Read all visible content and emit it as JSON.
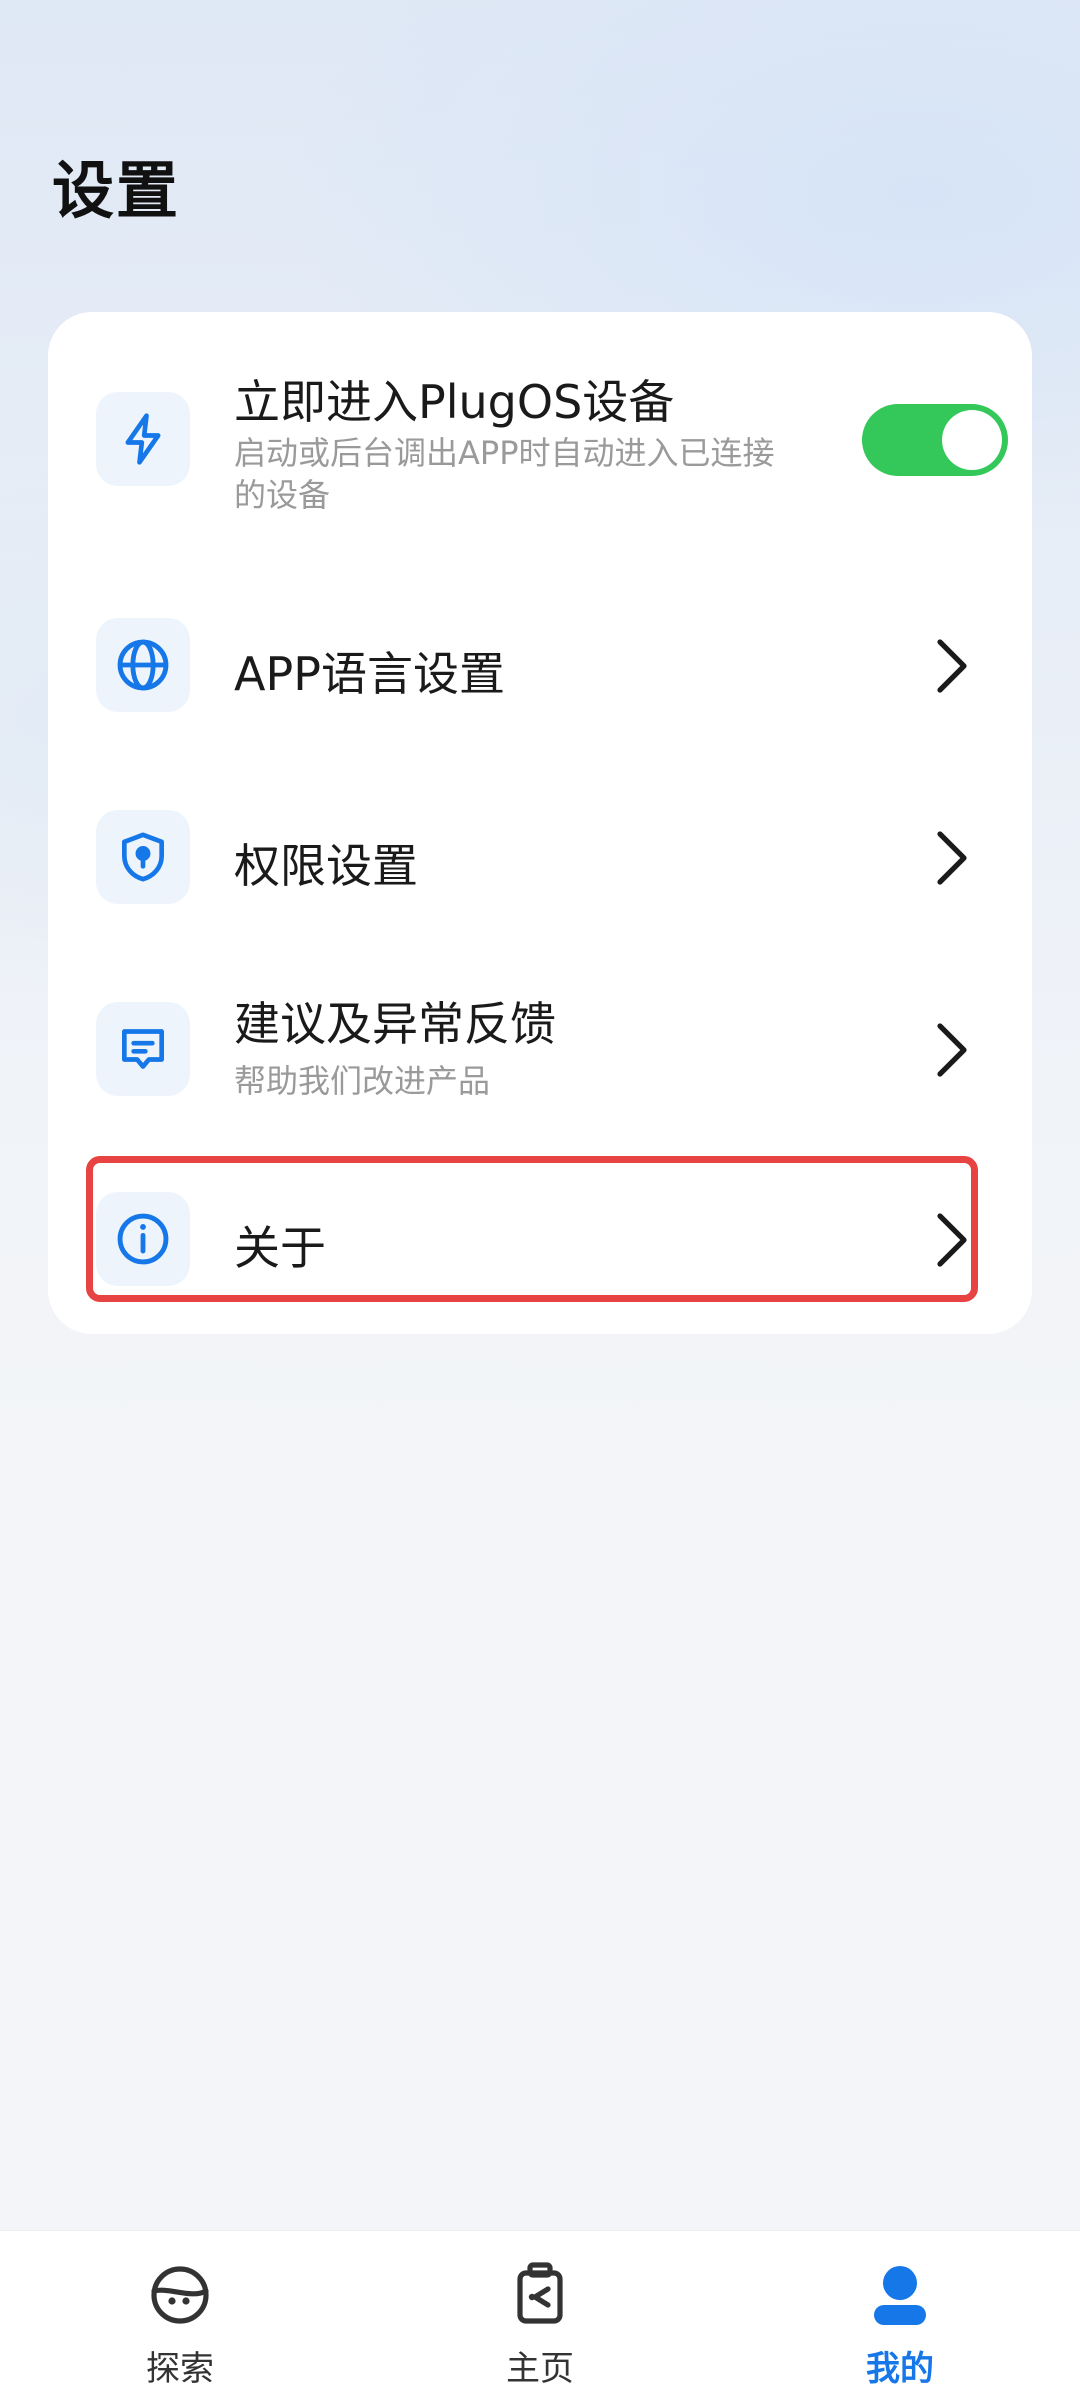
{
  "header": {
    "title": "设置"
  },
  "settings": {
    "items": [
      {
        "title": "立即进入PlugOS设备",
        "subtitle": "启动或后台调出APP时自动进入已连接的设备",
        "icon": "lightning-icon",
        "control": "toggle",
        "toggle_on": true
      },
      {
        "title": "APP语言设置",
        "icon": "globe-icon",
        "control": "chevron"
      },
      {
        "title": "权限设置",
        "icon": "shield-icon",
        "control": "chevron"
      },
      {
        "title": "建议及异常反馈",
        "subtitle": "帮助我们改进产品",
        "icon": "message-icon",
        "control": "chevron"
      },
      {
        "title": "关于",
        "icon": "info-icon",
        "control": "chevron",
        "highlighted": true
      }
    ]
  },
  "tabbar": {
    "tabs": [
      {
        "label": "探索",
        "icon": "explore-icon",
        "active": false
      },
      {
        "label": "主页",
        "icon": "home-device-icon",
        "active": false
      },
      {
        "label": "我的",
        "icon": "profile-icon",
        "active": true
      }
    ]
  },
  "colors": {
    "accent": "#1677e8",
    "toggle_on": "#34c759",
    "highlight_border": "#e84343",
    "icon_bg": "#eef4fb"
  }
}
